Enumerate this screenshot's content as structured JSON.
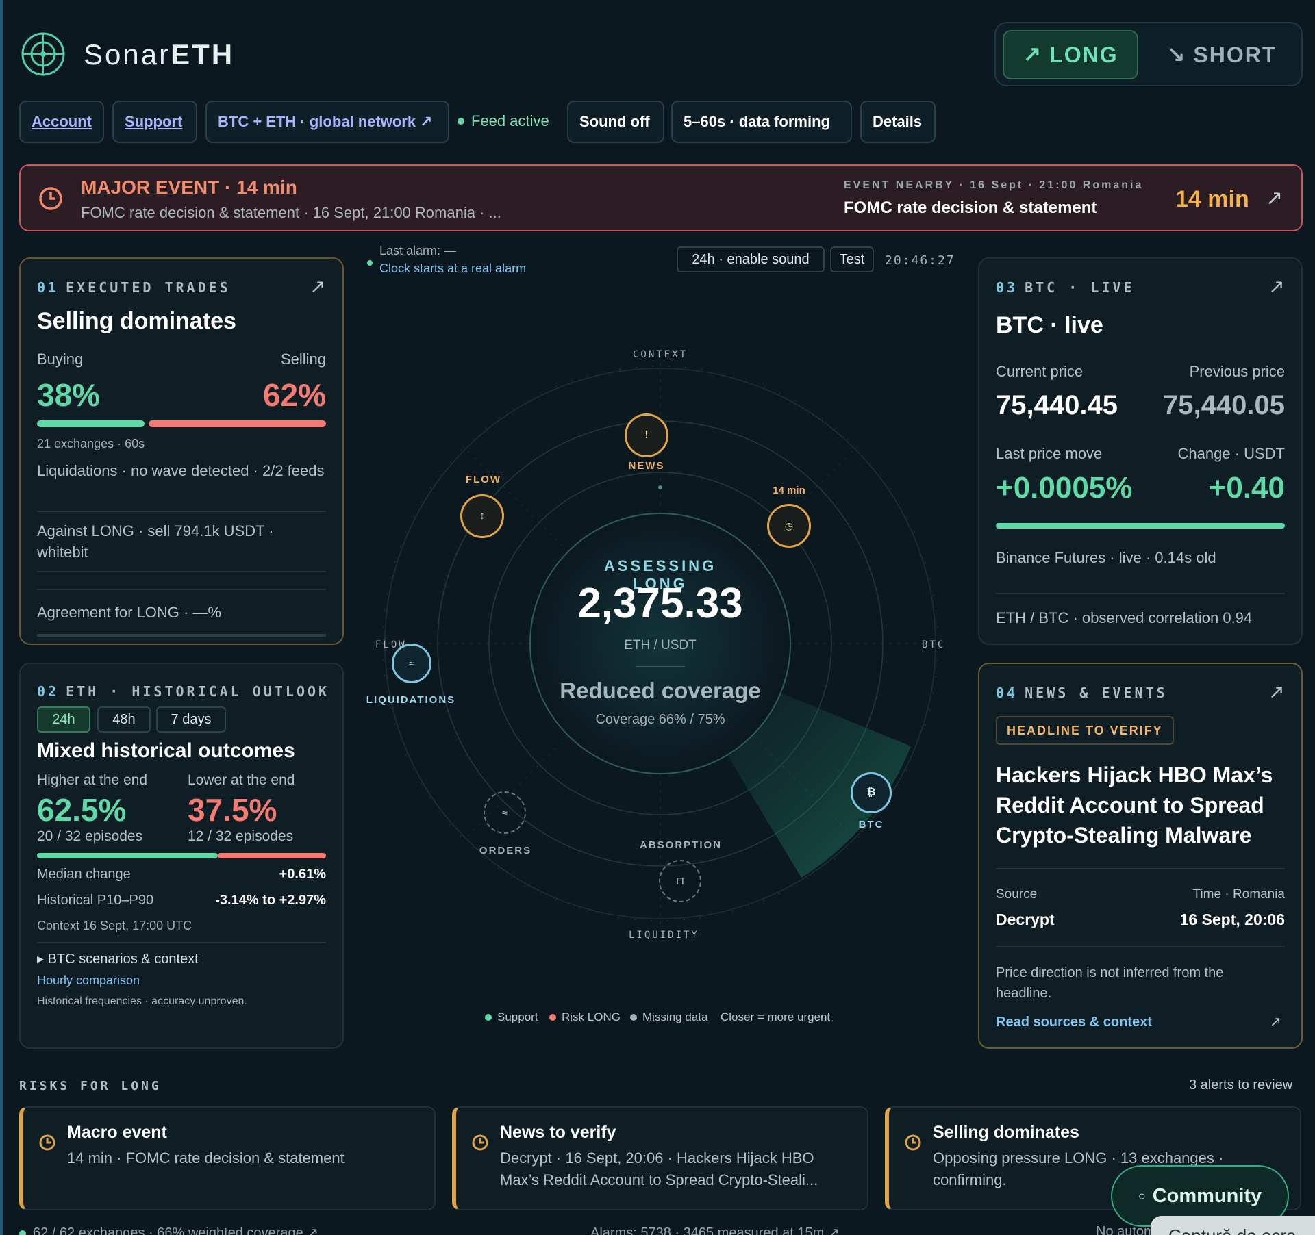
{
  "brand": {
    "name_light": "Sonar",
    "name_bold": "ETH"
  },
  "direction": {
    "long": "LONG",
    "short": "SHORT",
    "long_icon": "arrow-up-right-icon",
    "short_icon": "arrow-down-right-icon"
  },
  "nav": {
    "account": "Account",
    "support": "Support",
    "network": "BTC + ETH · global network ↗",
    "feed": "Feed active",
    "sound": "Sound off",
    "forming": "5–60s · data forming",
    "details": "Details"
  },
  "banner": {
    "title": "MAJOR EVENT · 14 min",
    "sub": "FOMC rate decision & statement · 16 Sept, 21:00 Romania · ...",
    "near_label": "EVENT NEARBY · 16 Sept · 21:00 Romania",
    "near_title": "FOMC rate decision & statement",
    "mins": "14 min",
    "arrow": "↗"
  },
  "trades": {
    "num": "01",
    "label": "EXECUTED TRADES",
    "arrow": "↗",
    "title": "Selling dominates",
    "buy_label": "Buying",
    "sell_label": "Selling",
    "buy_pct": "38%",
    "sell_pct": "62%",
    "buy_fraction": 0.38,
    "exchanges": "21 exchanges · 60s",
    "liquidations": "Liquidations · no wave detected · 2/2 feeds",
    "against": "Against LONG · sell 794.1k USDT · whitebit",
    "agreement": "Agreement for LONG · —%"
  },
  "history": {
    "num": "02",
    "label": "ETH · HISTORICAL OUTLOOK",
    "tabs": [
      "24h",
      "48h",
      "7 days"
    ],
    "title": "Mixed historical outcomes",
    "higher_label": "Higher at the end",
    "lower_label": "Lower at the end",
    "higher_pct": "62.5%",
    "lower_pct": "37.5%",
    "higher_fraction": 0.625,
    "higher_eps": "20 / 32 episodes",
    "lower_eps": "12 / 32 episodes",
    "median_label": "Median change",
    "median_val": "+0.61%",
    "p_label": "Historical P10–P90",
    "p_val": "-3.14% to +2.97%",
    "context": "Context 16 Sept, 17:00 UTC",
    "scenarios": "▸ BTC scenarios & context",
    "hourly": "Hourly comparison",
    "note": "Historical frequencies · accuracy unproven."
  },
  "radar": {
    "last_alarm": "Last alarm: —",
    "clock_note": "Clock starts at a real alarm",
    "enable_sound": "24h · enable sound",
    "test": "Test",
    "time": "20:46:27",
    "ring_labels": {
      "top": "CONTEXT",
      "left": "FLOW",
      "right": "BTC",
      "bottom": "LIQUIDITY"
    },
    "assessing": "ASSESSING LONG",
    "price": "2,375.33",
    "pair": "ETH / USDT",
    "coverage_title": "Reduced coverage",
    "coverage": "Coverage 66% / 75%",
    "nodes": {
      "news": {
        "label": "NEWS",
        "glyph": "!"
      },
      "min": {
        "label": "14 min",
        "glyph": "◷"
      },
      "flow": {
        "label": "FLOW",
        "glyph": "↕"
      },
      "liq": {
        "label": "LIQUIDATIONS",
        "glyph": "≈"
      },
      "orders": {
        "label": "ORDERS",
        "glyph": "≈"
      },
      "absorption": {
        "label": "ABSORPTION",
        "glyph": "⊓"
      },
      "btc": {
        "label": "BTC",
        "glyph": "₿"
      }
    },
    "legend": {
      "support": "Support",
      "risk": "Risk LONG",
      "missing": "Missing data",
      "closer": "Closer = more urgent"
    }
  },
  "btc": {
    "num": "03",
    "label": "BTC · LIVE",
    "arrow": "↗",
    "title": "BTC · live",
    "cur_label": "Current price",
    "prev_label": "Previous price",
    "cur": "75,440.45",
    "prev": "75,440.05",
    "move_label": "Last price move",
    "change_label": "Change · USDT",
    "move": "+0.0005%",
    "change": "+0.40",
    "source": "Binance Futures · live · 0.14s old",
    "corr": "ETH / BTC · observed correlation 0.94"
  },
  "news": {
    "num": "04",
    "label": "NEWS & EVENTS",
    "arrow": "↗",
    "badge": "HEADLINE TO VERIFY",
    "headline": "Hackers Hijack HBO Max’s Reddit Account to Spread Crypto-Stealing Malware",
    "source_label": "Source",
    "time_label": "Time · Romania",
    "source": "Decrypt",
    "time": "16 Sept, 20:06",
    "note": "Price direction is not inferred from the headline.",
    "link": "Read sources & context",
    "link_arrow": "↗"
  },
  "risks": {
    "title": "RISKS FOR LONG",
    "count": "3 alerts to review",
    "items": [
      {
        "title": "Macro event",
        "desc": "14 min · FOMC rate decision & statement"
      },
      {
        "title": "News to verify",
        "desc": "Decrypt · 16 Sept, 20:06 · Hackers Hijack HBO Max’s Reddit Account to Spread Crypto-Steali..."
      },
      {
        "title": "Selling dominates",
        "desc": "Opposing pressure LONG · 13 exchanges · confirming."
      }
    ]
  },
  "community": "Community",
  "capture": "Captură de ecra",
  "footer": {
    "left": "62 / 62 exchanges · 66% weighted coverage ↗",
    "mid": "Alarms: 5738 · 3465 measured at 15m ↗",
    "right": "No autom"
  },
  "colors": {
    "green": "#5fd9a5",
    "red": "#f47a72",
    "amber": "#f5b14a",
    "banner_border": "#c9565a"
  }
}
